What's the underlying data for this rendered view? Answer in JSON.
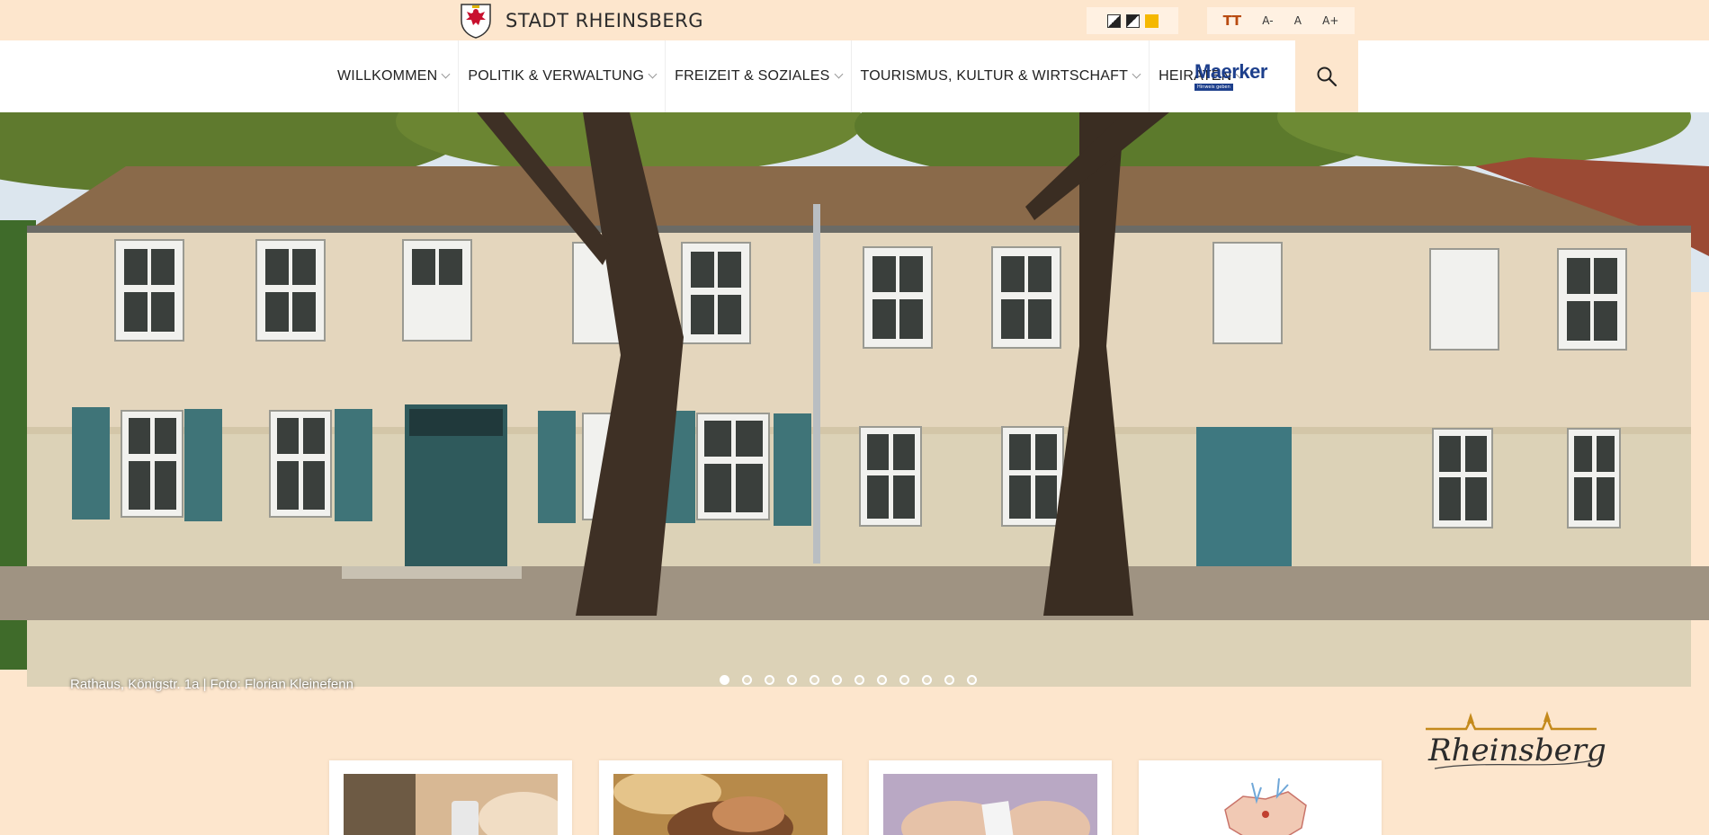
{
  "header": {
    "brand_name": "STADT RHEINSBERG",
    "crest_icon": "city-crest-eagle-icon",
    "contrast_options": [
      "contrast-standard",
      "contrast-inverted",
      "contrast-yellow"
    ],
    "font_size_controls": {
      "icon": "font-size-icon",
      "decrease": "A-",
      "reset": "A",
      "increase": "A+"
    }
  },
  "nav": {
    "items": [
      {
        "label": "WILLKOMMEN"
      },
      {
        "label": "POLITIK & VERWALTUNG"
      },
      {
        "label": "FREIZEIT & SOZIALES"
      },
      {
        "label": "TOURISMUS, KULTUR & WIRTSCHAFT"
      },
      {
        "label": "HEIRATEN"
      }
    ],
    "maerker": {
      "word": "Maerker",
      "tagline": "Hinweis geben"
    },
    "search_icon": "search-icon"
  },
  "hero": {
    "caption": "Rathaus, Königstr. 1a | Foto: Florian Kleinefenn",
    "slide_count": 12,
    "active_slide": 1
  },
  "logo": {
    "text": "Rheinsberg"
  },
  "cards": [
    {
      "image": "hands-with-smartphone"
    },
    {
      "image": "holding-hands"
    },
    {
      "image": "hands-with-card"
    },
    {
      "image": "region-map"
    }
  ],
  "colors": {
    "background": "#fde6cd",
    "accent": "#b94b10",
    "maerker_blue": "#1d3f8c"
  }
}
